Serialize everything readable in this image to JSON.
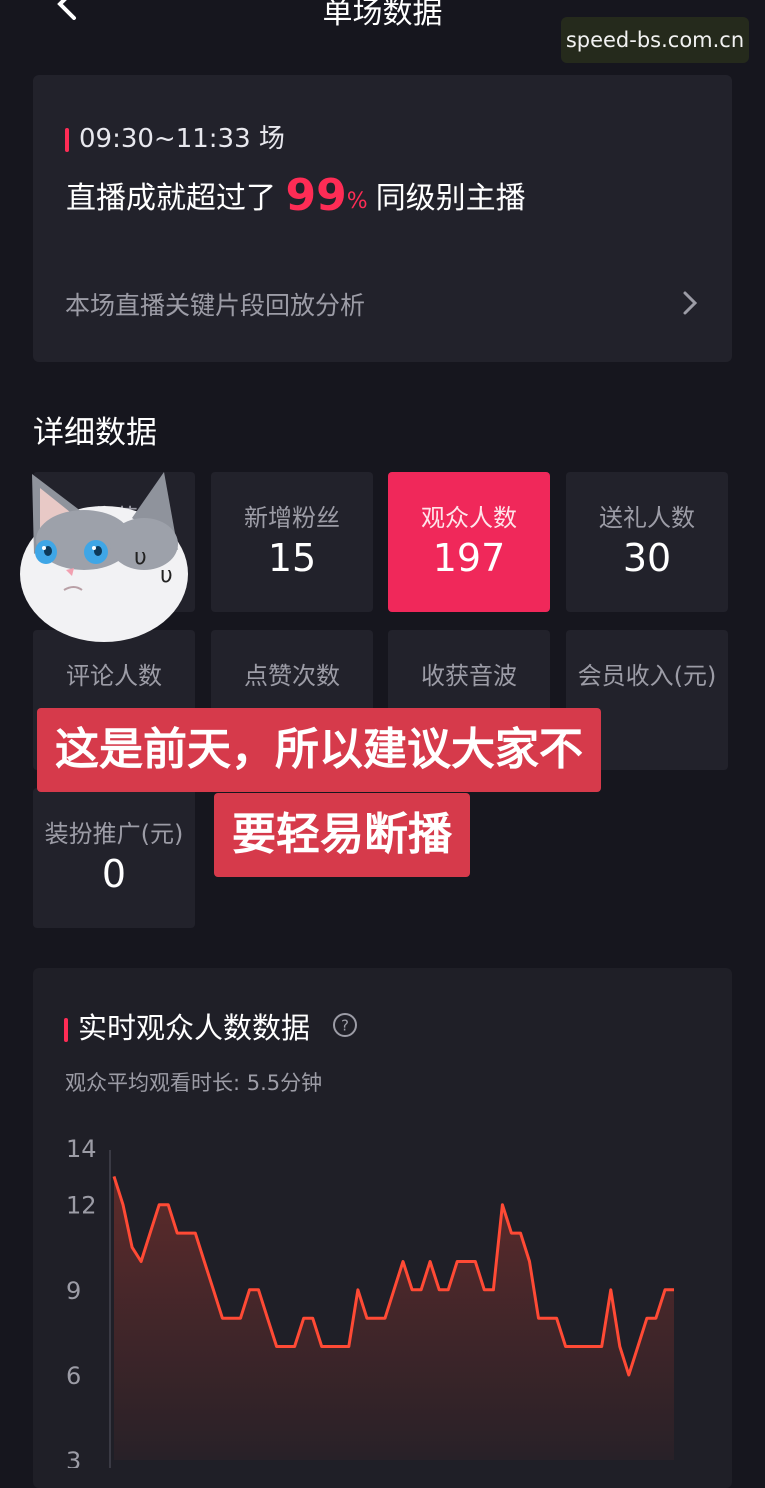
{
  "header": {
    "title": "单场数据",
    "back_icon": "chevron-left-icon"
  },
  "watermark": "speed-bs.com.cn",
  "summary": {
    "session_time": "09:30~11:33 场",
    "achievement_prefix": "直播成就超过了",
    "achievement_value": "99",
    "achievement_percent": "%",
    "achievement_suffix": "同级别主播",
    "replay_label": "本场直播关键片段回放分析"
  },
  "detail": {
    "title": "详细数据",
    "tiles": [
      {
        "label": "收获",
        "value": ""
      },
      {
        "label": "新增粉丝",
        "value": "15"
      },
      {
        "label": "观众人数",
        "value": "197"
      },
      {
        "label": "送礼人数",
        "value": "30"
      },
      {
        "label": "评论人数",
        "value": ""
      },
      {
        "label": "点赞次数",
        "value": ""
      },
      {
        "label": "收获音波",
        "value": ""
      },
      {
        "label": "会员收入(元)",
        "value": ""
      },
      {
        "label": "装扮推广(元)",
        "value": "0"
      }
    ],
    "active_tile": "观众人数"
  },
  "caption": {
    "line1": "这是前天，所以建议大家不",
    "line2": "要轻易断播"
  },
  "chart": {
    "title": "实时观众人数数据",
    "subtitle": "观众平均观看时长: 5.5分钟"
  },
  "colors": {
    "accent": "#fe2c55",
    "line": "#ff4a35",
    "background": "#16161e",
    "card": "#22222b"
  },
  "chart_data": {
    "type": "area",
    "title": "",
    "xlabel": "",
    "ylabel": "",
    "y_ticks": [
      "14",
      "12",
      "9",
      "6",
      "3"
    ],
    "ylim": [
      3,
      14
    ],
    "grid": false,
    "series": [
      {
        "values": [
          13,
          12,
          10.5,
          10,
          11,
          12,
          12,
          11,
          11,
          11,
          10,
          9,
          8,
          8,
          8,
          9,
          9,
          8,
          7,
          7,
          7,
          8,
          8,
          7,
          7,
          7,
          7,
          9,
          8,
          8,
          8,
          9,
          10,
          9,
          9,
          10,
          9,
          9,
          10,
          10,
          10,
          9,
          9,
          12,
          11,
          11,
          10,
          8,
          8,
          8,
          7,
          7,
          7,
          7,
          7,
          9,
          7,
          6,
          7,
          8,
          8,
          9,
          9
        ]
      }
    ]
  }
}
